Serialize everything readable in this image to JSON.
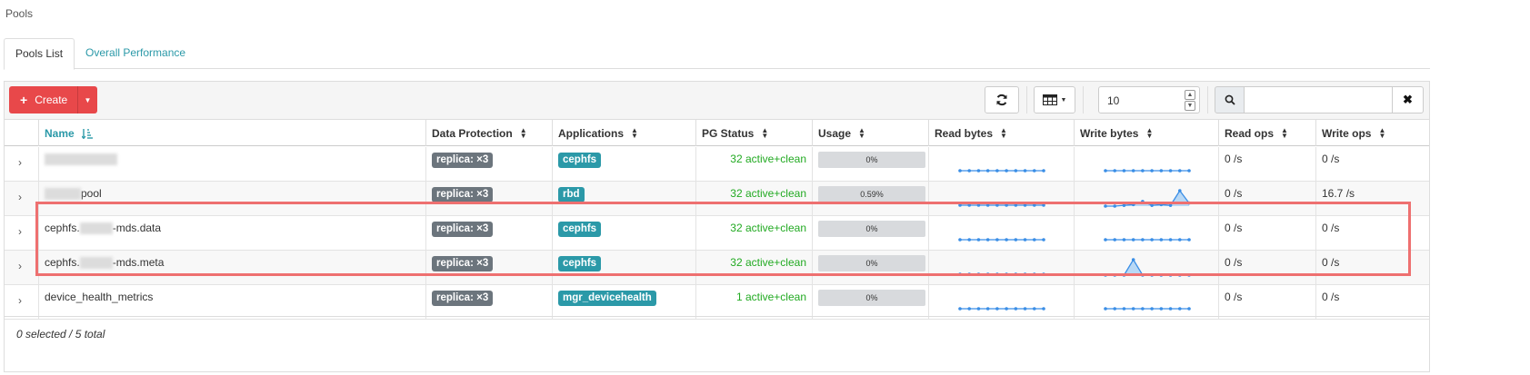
{
  "breadcrumb": "Pools",
  "tabs": [
    {
      "label": "Pools List",
      "active": true
    },
    {
      "label": "Overall Performance",
      "active": false
    }
  ],
  "toolbar": {
    "create_label": "Create",
    "page_size": "10",
    "search_placeholder": ""
  },
  "columns": [
    "Name",
    "Data Protection",
    "Applications",
    "PG Status",
    "Usage",
    "Read bytes",
    "Write bytes",
    "Read ops",
    "Write ops"
  ],
  "rows": [
    {
      "name_suffix": "",
      "protection": "replica: ×3",
      "application": "cephfs",
      "pg_status": "32 active+clean",
      "usage": "0%",
      "read_ops": "0 /s",
      "write_ops": "0 /s"
    },
    {
      "name_suffix": "pool",
      "protection": "replica: ×3",
      "application": "rbd",
      "pg_status": "32 active+clean",
      "usage": "0.59%",
      "read_ops": "0 /s",
      "write_ops": "16.7 /s"
    },
    {
      "name_prefix": "cephfs.",
      "name_suffix": "-mds.data",
      "protection": "replica: ×3",
      "application": "cephfs",
      "pg_status": "32 active+clean",
      "usage": "0%",
      "read_ops": "0 /s",
      "write_ops": "0 /s"
    },
    {
      "name_prefix": "cephfs.",
      "name_suffix": "-mds.meta",
      "protection": "replica: ×3",
      "application": "cephfs",
      "pg_status": "32 active+clean",
      "usage": "0%",
      "read_ops": "0 /s",
      "write_ops": "0 /s"
    },
    {
      "name": "device_health_metrics",
      "protection": "replica: ×3",
      "application": "mgr_devicehealth",
      "pg_status": "1 active+clean",
      "usage": "0%",
      "read_ops": "0 /s",
      "write_ops": "0 /s"
    }
  ],
  "sparklines": {
    "flat": [
      0,
      0,
      0,
      0,
      0,
      0,
      0,
      0,
      0,
      0
    ],
    "pool_write": [
      0,
      0,
      0.05,
      0.1,
      0.3,
      0.05,
      0.1,
      0.05,
      1,
      0.2
    ],
    "meta_write": [
      0,
      0,
      0,
      1,
      0,
      0,
      0,
      0,
      0,
      0
    ]
  },
  "footer": "0 selected / 5 total",
  "colors": {
    "accent": "#2b99a8",
    "danger": "#e8484a",
    "success": "#22aa22",
    "highlight": "#ee7070"
  },
  "icons": [
    "refresh-icon",
    "table-columns-icon",
    "search-icon",
    "close-icon",
    "plus-icon",
    "sort-icon"
  ]
}
